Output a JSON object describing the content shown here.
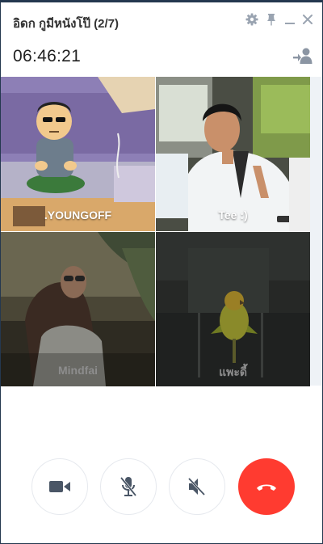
{
  "window": {
    "title": "อิดก กูมีหนังโป๊ (2/7)",
    "icons": [
      "gear-icon",
      "pin-icon",
      "minimize-icon",
      "close-icon"
    ]
  },
  "call": {
    "timer": "06:46:21",
    "add_participant_icon": "add-user-icon"
  },
  "participants": [
    {
      "name": ".YOUNGOFF",
      "video_on": true
    },
    {
      "name": "Tee :)",
      "video_on": true
    },
    {
      "name": "Mindfai",
      "video_on": false
    },
    {
      "name": "แพะดี้",
      "video_on": false
    }
  ],
  "controls": [
    {
      "id": "video",
      "icon": "video-camera-icon"
    },
    {
      "id": "mic",
      "icon": "mic-muted-icon"
    },
    {
      "id": "speaker",
      "icon": "speaker-muted-icon"
    },
    {
      "id": "end",
      "icon": "hang-up-icon"
    }
  ],
  "colors": {
    "accent_end_call": "#ff3b30",
    "control_icon": "#4a5666",
    "frame_border": "#24384f"
  }
}
